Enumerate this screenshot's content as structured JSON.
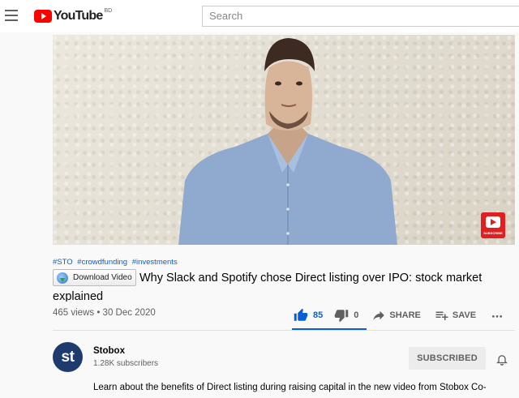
{
  "masthead": {
    "logo_text": "YouTube",
    "country_code": "BD",
    "search_placeholder": "Search"
  },
  "video": {
    "subscribe_watermark": "SUBSCRIBE",
    "hashtags": [
      "#STO",
      "#crowdfunding",
      "#investments"
    ],
    "download_button": "Download Video",
    "title": "Why Slack and Spotify chose Direct listing over IPO: stock market explained",
    "views_date": "465 views • 30 Dec 2020",
    "actions": {
      "like_count": "85",
      "dislike_count": "0",
      "share_label": "SHARE",
      "save_label": "SAVE"
    }
  },
  "channel": {
    "avatar_text": "st",
    "name": "Stobox",
    "subscribers": "1.28K subscribers",
    "subscribed_label": "SUBSCRIBED"
  },
  "description": "Learn about the benefits of Direct listing during raising capital in the new video from Stobox Co-",
  "colors": {
    "accent": "#065fd4",
    "brand_red": "#ff0000",
    "avatar_bg": "#1f3b6e"
  }
}
